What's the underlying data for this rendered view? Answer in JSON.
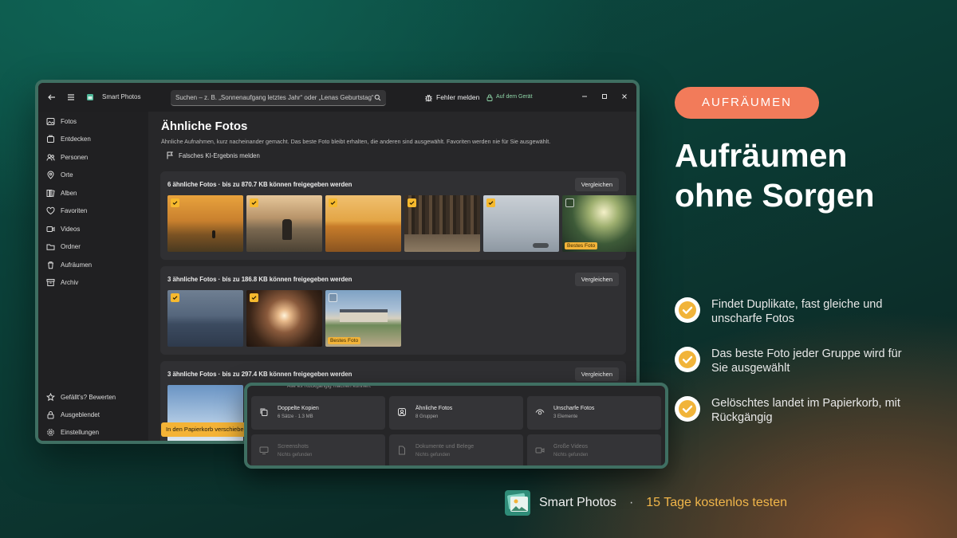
{
  "app": {
    "title": "Smart Photos",
    "search_placeholder": "Suchen – z. B. „Sonnenaufgang letztes Jahr“ oder „Lenas Geburtstag“",
    "report_label": "Fehler melden",
    "on_device_label": "Auf dem Gerät"
  },
  "sidebar": {
    "items": [
      {
        "label": "Fotos",
        "icon": "image-icon"
      },
      {
        "label": "Entdecken",
        "icon": "explore-icon"
      },
      {
        "label": "Personen",
        "icon": "people-icon"
      },
      {
        "label": "Orte",
        "icon": "location-icon"
      },
      {
        "label": "Alben",
        "icon": "albums-icon"
      },
      {
        "label": "Favoriten",
        "icon": "heart-icon"
      },
      {
        "label": "Videos",
        "icon": "video-icon"
      },
      {
        "label": "Ordner",
        "icon": "folder-icon"
      },
      {
        "label": "Aufräumen",
        "icon": "trash-icon"
      },
      {
        "label": "Archiv",
        "icon": "archive-icon"
      }
    ],
    "bottom_items": [
      {
        "label": "Gefällt's? Bewerten",
        "icon": "star-icon"
      },
      {
        "label": "Ausgeblendet",
        "icon": "lock-icon"
      },
      {
        "label": "Einstellungen",
        "icon": "gear-icon"
      }
    ]
  },
  "main": {
    "title": "Ähnliche Fotos",
    "description": "Ähnliche Aufnahmen, kurz nacheinander gemacht. Das beste Foto bleibt erhalten, die anderen sind ausgewählt. Favoriten werden nie für Sie ausgewählt.",
    "flag_label": "Falsches KI-Ergebnis melden",
    "compare_label": "Vergleichen",
    "best_label": "Bestes Foto",
    "trash_button": "In den Papierkorb verschieben",
    "groups": [
      {
        "title": "6 ähnliche Fotos · bis zu 870.7 KB können freigegeben werden"
      },
      {
        "title": "3 ähnliche Fotos · bis zu 186.8 KB können freigegeben werden"
      },
      {
        "title": "3 ähnliche Fotos · bis zu 297.4 KB können freigegeben werden"
      }
    ]
  },
  "overlay": {
    "top_text": "Alle es Rückgängig machen können.",
    "cards": [
      {
        "title": "Doppelte Kopien",
        "sub": "6 Sätze · 1.3 MB",
        "icon": "copy-icon"
      },
      {
        "title": "Ähnliche Fotos",
        "sub": "8 Gruppen",
        "icon": "similar-photos-icon"
      },
      {
        "title": "Unscharfe Fotos",
        "sub": "3 Elemente",
        "icon": "eye-icon"
      },
      {
        "title": "Screenshots",
        "sub": "Nichts gefunden",
        "icon": "monitor-icon"
      },
      {
        "title": "Dokumente und Belege",
        "sub": "Nichts gefunden",
        "icon": "document-icon"
      },
      {
        "title": "Große Videos",
        "sub": "Nichts gefunden",
        "icon": "video-icon"
      }
    ]
  },
  "promo": {
    "badge": "AUFRÄUMEN",
    "headline_line1": "Aufräumen",
    "headline_line2": "ohne Sorgen",
    "features": [
      "Findet Duplikate, fast gleiche und unscharfe Fotos",
      "Das beste Foto jeder Gruppe wird für Sie ausgewählt",
      "Gelöschtes landet im Papierkorb, mit Rückgängig"
    ],
    "brand": "Smart Photos",
    "separator": "·",
    "trial": "15 Tage kostenlos testen"
  },
  "colors": {
    "accent": "#f4b336",
    "badge": "#f27b5a",
    "trial": "#f1b64a"
  }
}
